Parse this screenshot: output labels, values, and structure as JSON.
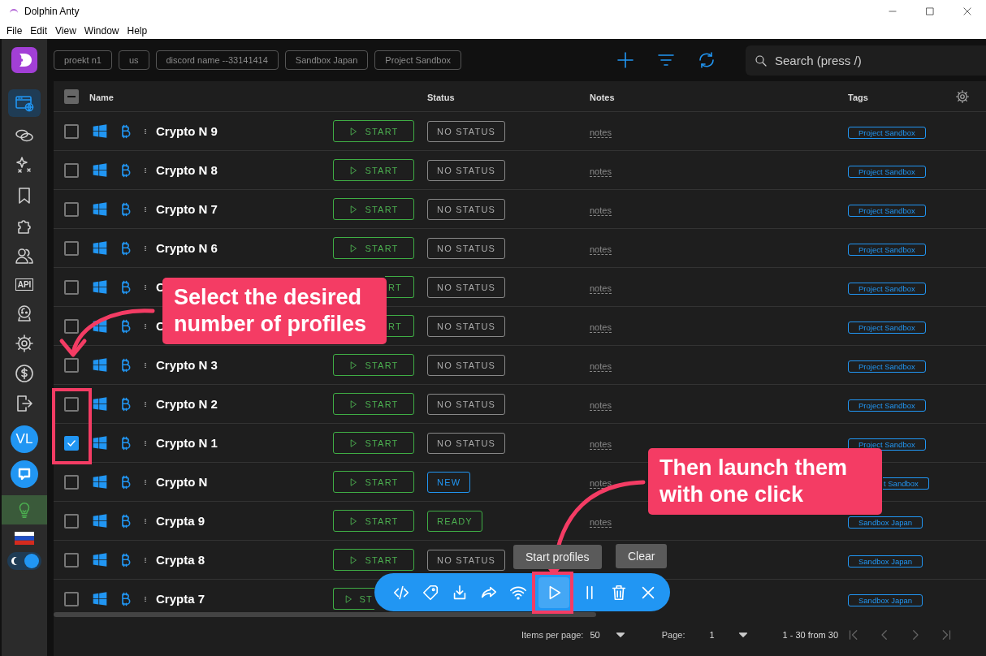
{
  "window": {
    "title": "Dolphin Anty"
  },
  "menu": [
    "File",
    "Edit",
    "View",
    "Window",
    "Help"
  ],
  "sidebar": {
    "items": [
      {
        "selected": true
      },
      {
        "selected": false
      },
      {
        "selected": false
      },
      {
        "selected": false
      },
      {
        "selected": false
      },
      {
        "selected": false
      },
      {
        "selected": false,
        "label": "API"
      },
      {
        "selected": false
      },
      {
        "selected": false
      },
      {
        "selected": false
      },
      {
        "selected": false
      }
    ],
    "avatar": "VL",
    "dark_mode": true
  },
  "filters": [
    "proekt n1",
    "us",
    "discord name --33141414",
    "Sandbox Japan",
    "Project Sandbox"
  ],
  "search": {
    "placeholder": "Search (press /)"
  },
  "table": {
    "columns": [
      "Name",
      "Status",
      "Notes",
      "Tags"
    ],
    "select_all": {
      "indeterminate": true
    },
    "rows": [
      {
        "name": "Crypto N 9",
        "checked": false,
        "start": "START",
        "status": {
          "label": "NO STATUS",
          "kind": "none"
        },
        "notes": "notes",
        "tag": "Project Sandbox"
      },
      {
        "name": "Crypto N 8",
        "checked": false,
        "start": "START",
        "status": {
          "label": "NO STATUS",
          "kind": "none"
        },
        "notes": "notes",
        "tag": "Project Sandbox"
      },
      {
        "name": "Crypto N 7",
        "checked": false,
        "start": "START",
        "status": {
          "label": "NO STATUS",
          "kind": "none"
        },
        "notes": "notes",
        "tag": "Project Sandbox"
      },
      {
        "name": "Crypto N 6",
        "checked": false,
        "start": "START",
        "status": {
          "label": "NO STATUS",
          "kind": "none"
        },
        "notes": "notes",
        "tag": "Project Sandbox"
      },
      {
        "name": "C",
        "checked": false,
        "start": "RT",
        "start_clipped_left": true,
        "status": {
          "label": "NO STATUS",
          "kind": "none"
        },
        "notes": "notes",
        "tag": "Project Sandbox"
      },
      {
        "name": "C",
        "checked": false,
        "start": "RT",
        "start_clipped_left": true,
        "status": {
          "label": "NO STATUS",
          "kind": "none"
        },
        "notes": "notes",
        "tag": "Project Sandbox"
      },
      {
        "name": "Crypto N 3",
        "checked": false,
        "start": "START",
        "status": {
          "label": "NO STATUS",
          "kind": "none"
        },
        "notes": "notes",
        "tag": "Project Sandbox"
      },
      {
        "name": "Crypto N 2",
        "checked": false,
        "start": "START",
        "status": {
          "label": "NO STATUS",
          "kind": "none"
        },
        "notes": "notes",
        "tag": "Project Sandbox"
      },
      {
        "name": "Crypto N 1",
        "checked": true,
        "start": "START",
        "status": {
          "label": "NO STATUS",
          "kind": "none"
        },
        "notes": "notes",
        "tag": "Project Sandbox"
      },
      {
        "name": "Crypto N",
        "checked": false,
        "start": "START",
        "status": {
          "label": "NEW",
          "kind": "new"
        },
        "notes": "notes",
        "tag": "t Sandbox",
        "tag_clipped_left": true
      },
      {
        "name": "Crypta 9",
        "checked": false,
        "start": "START",
        "status": {
          "label": "READY",
          "kind": "ready"
        },
        "notes": "notes",
        "tag": "Sandbox Japan"
      },
      {
        "name": "Crypta 8",
        "checked": false,
        "start": "START",
        "status": {
          "label": "NO STATUS",
          "kind": "none"
        },
        "tag": "Sandbox Japan"
      },
      {
        "name": "Crypta 7",
        "checked": false,
        "start": "ST",
        "start_clipped_right": true,
        "tag": "Sandbox Japan"
      }
    ]
  },
  "tooltips": [
    "Start profiles",
    "Clear"
  ],
  "action_bar": [
    {
      "hovered": false
    },
    {
      "hovered": false
    },
    {
      "hovered": false
    },
    {
      "hovered": false
    },
    {
      "hovered": false
    },
    {
      "hovered": true
    },
    {
      "hovered": false
    },
    {
      "hovered": false
    },
    {
      "hovered": false
    }
  ],
  "pagination": {
    "items_label": "Items per page:",
    "items_value": "50",
    "page_label": "Page:",
    "page_value": "1",
    "range": "1 - 30 from 30"
  },
  "callouts": [
    "Select the desired number of profiles",
    "Then launch them with one click"
  ]
}
